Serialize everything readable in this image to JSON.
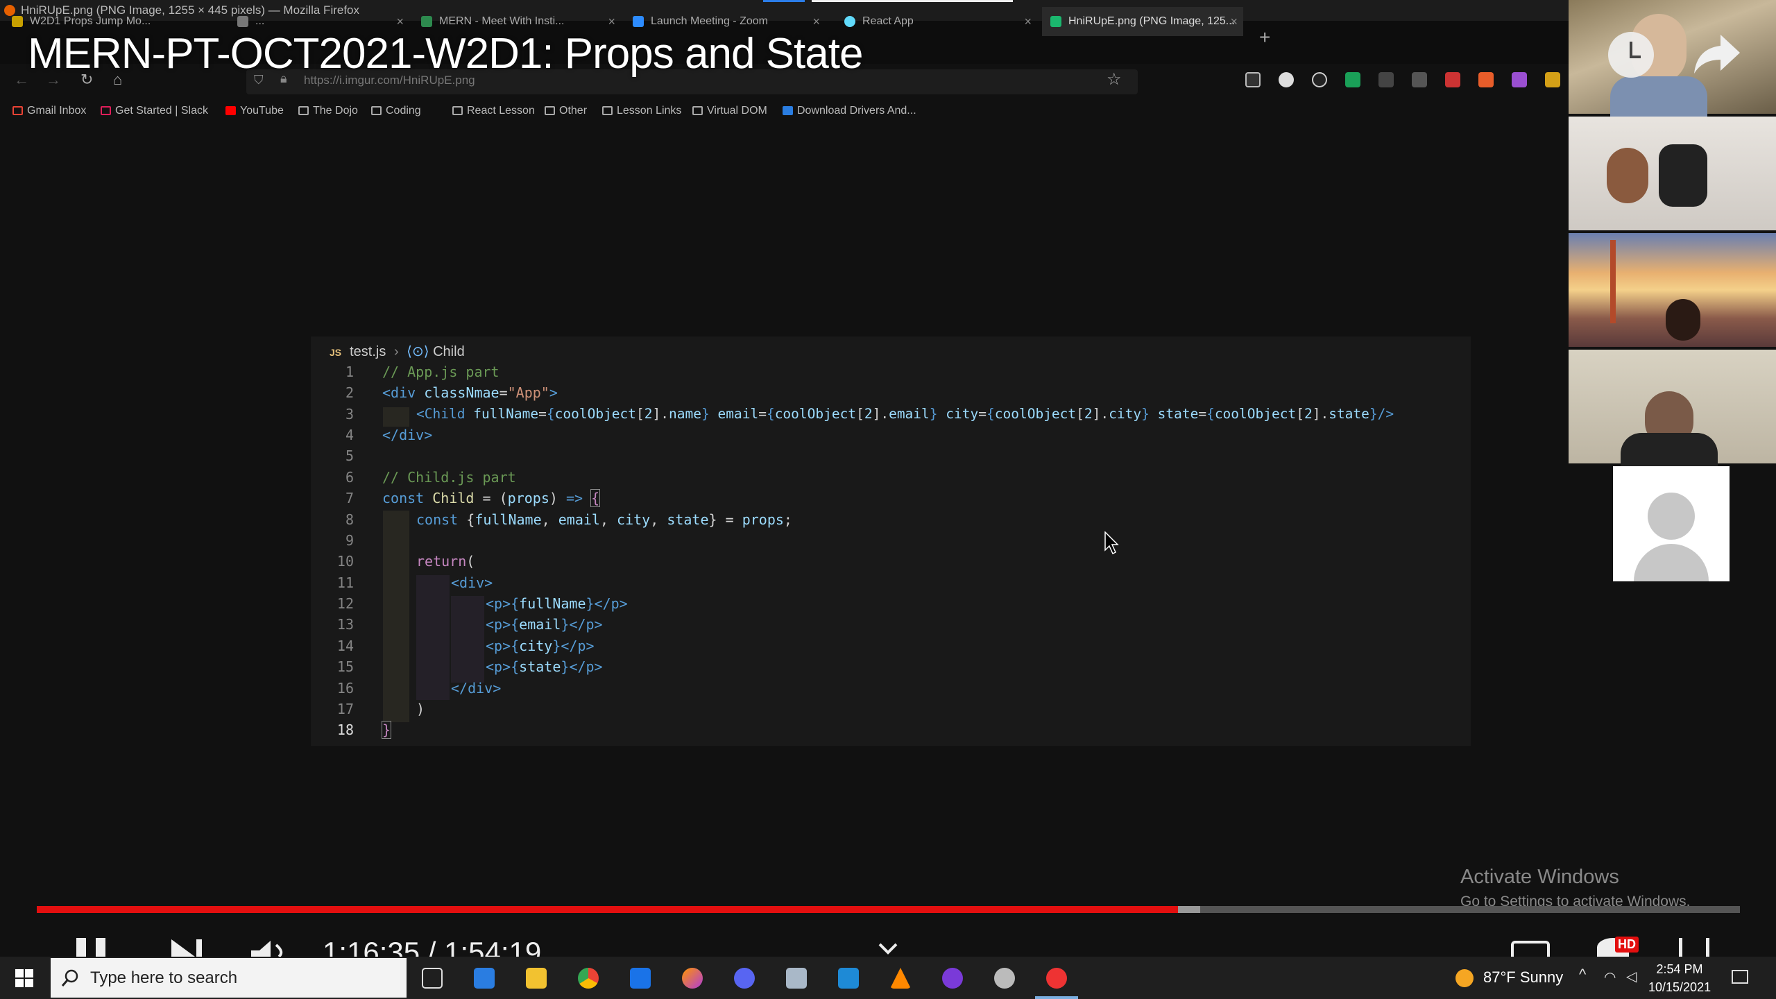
{
  "window_title": "HniRUpE.png (PNG Image, 1255 × 445 pixels) — Mozilla Firefox",
  "video_title": "MERN-PT-OCT2021-W2D1: Props and State",
  "tabs": [
    {
      "label": "W2D1 Props Jump Mo...",
      "color": "#c8a000"
    },
    {
      "label": "...",
      "color": "#777777"
    },
    {
      "label": "MERN - Meet With Insti...",
      "color": "#2d8a4e"
    },
    {
      "label": "Launch Meeting - Zoom",
      "color": "#2d8cff"
    },
    {
      "label": "React App",
      "color": "#61dafb"
    },
    {
      "label": "HniRUpE.png (PNG Image, 125...",
      "color": "#1bb76e"
    }
  ],
  "new_tab": "+",
  "url": "https://i.imgur.com/HniRUpE.png",
  "bookmarks": [
    {
      "label": "Gmail Inbox",
      "icon": "gmail-icon"
    },
    {
      "label": "Get Started | Slack",
      "icon": "slack-icon"
    },
    {
      "label": "YouTube",
      "icon": "youtube-icon"
    },
    {
      "label": "The Dojo",
      "icon": "folder-icon"
    },
    {
      "label": "Coding",
      "icon": "folder-icon"
    },
    {
      "label": "React Lesson",
      "icon": "folder-icon"
    },
    {
      "label": "Other",
      "icon": "folder-icon"
    },
    {
      "label": "Lesson Links",
      "icon": "folder-icon"
    },
    {
      "label": "Virtual DOM",
      "icon": "folder-icon"
    },
    {
      "label": "Download Drivers And...",
      "icon": "download-icon"
    }
  ],
  "editor": {
    "file": "test.js",
    "symbol": "Child",
    "lang_badge": "JS",
    "line_numbers": [
      "1",
      "2",
      "3",
      "4",
      "5",
      "6",
      "7",
      "8",
      "9",
      "10",
      "11",
      "12",
      "13",
      "14",
      "15",
      "16",
      "17",
      "18"
    ]
  },
  "activate": {
    "title": "Activate Windows",
    "subtitle": "Go to Settings to activate Windows."
  },
  "player": {
    "timecode": "1:16:35 / 1:54:19",
    "progress_fraction": 0.67,
    "buffered_fraction": 0.683,
    "quality_badge": "HD"
  },
  "taskbar": {
    "search_placeholder": "Type here to search",
    "weather": "87°F  Sunny",
    "time": "2:54 PM",
    "date": "10/15/2021"
  },
  "colors": {
    "accent_red": "#e30f0f",
    "taskbar": "#1f1f1f",
    "code_bg": "#191919"
  }
}
